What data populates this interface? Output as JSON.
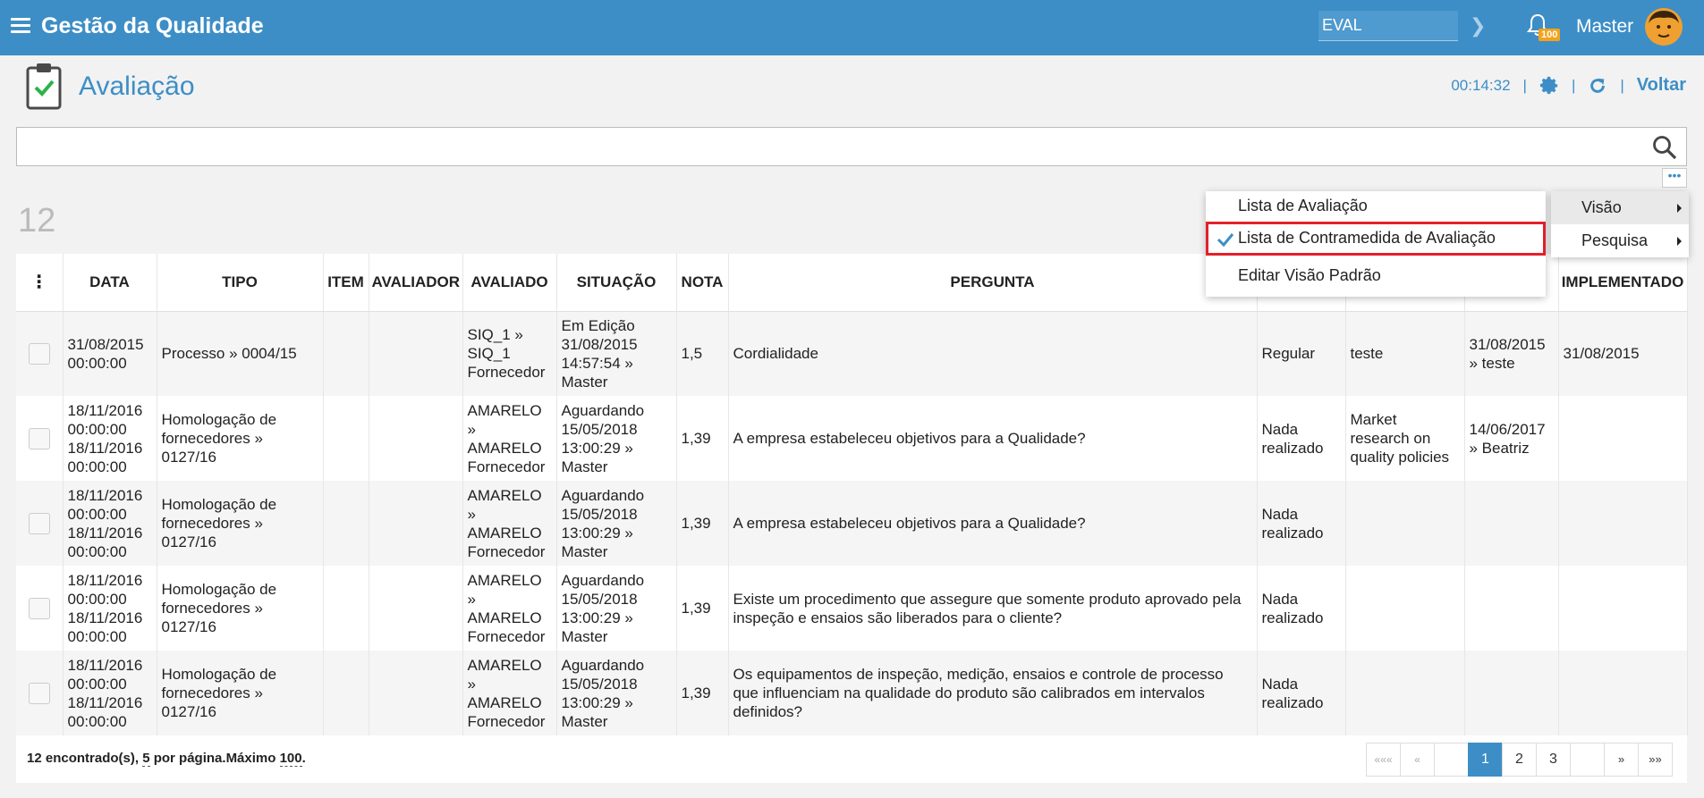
{
  "topbar": {
    "app_title": "Gestão da Qualidade",
    "env_value": "EVAL",
    "notification_count": "100",
    "user_name": "Master"
  },
  "page": {
    "title": "Avaliação",
    "timer": "00:14:32",
    "back_label": "Voltar"
  },
  "search": {
    "value": "",
    "placeholder": ""
  },
  "record_count": "12",
  "table": {
    "headers": [
      "DATA",
      "TIPO",
      "ITEM",
      "AVALIADOR",
      "AVALIADO",
      "SITUAÇÃO",
      "NOTA",
      "PERGUNTA",
      "",
      "",
      "",
      "IMPLEMENTADO"
    ],
    "rows": [
      {
        "data": [
          "31/08/2015",
          "00:00:00"
        ],
        "tipo": "Processo » 0004/15",
        "item": "",
        "avaliador": "",
        "avaliado": [
          "SIQ_1 »",
          "SIQ_1",
          "Fornecedor"
        ],
        "situacao": [
          "Em Edição",
          "31/08/2015",
          "14:57:54 »",
          "Master"
        ],
        "nota": "1,5",
        "pergunta": "Cordialidade",
        "resposta": "Regular",
        "acao": "teste",
        "prazo": "31/08/2015 » teste",
        "implementado": "31/08/2015"
      },
      {
        "data": [
          "18/11/2016",
          "00:00:00",
          "18/11/2016",
          "00:00:00"
        ],
        "tipo": "Homologação de fornecedores » 0127/16",
        "item": "",
        "avaliador": "",
        "avaliado": [
          "AMARELO »",
          "AMARELO",
          "Fornecedor"
        ],
        "situacao": [
          "Aguardando",
          "15/05/2018",
          "13:00:29 »",
          "Master"
        ],
        "nota": "1,39",
        "pergunta": "A empresa estabeleceu objetivos para a Qualidade?",
        "resposta": "Nada realizado",
        "acao": "Market research on quality policies",
        "prazo": "14/06/2017 » Beatriz",
        "implementado": ""
      },
      {
        "data": [
          "18/11/2016",
          "00:00:00",
          "18/11/2016",
          "00:00:00"
        ],
        "tipo": "Homologação de fornecedores » 0127/16",
        "item": "",
        "avaliador": "",
        "avaliado": [
          "AMARELO »",
          "AMARELO",
          "Fornecedor"
        ],
        "situacao": [
          "Aguardando",
          "15/05/2018",
          "13:00:29 »",
          "Master"
        ],
        "nota": "1,39",
        "pergunta": "A empresa estabeleceu objetivos para a Qualidade?",
        "resposta": "Nada realizado",
        "acao": "",
        "prazo": "",
        "implementado": ""
      },
      {
        "data": [
          "18/11/2016",
          "00:00:00",
          "18/11/2016",
          "00:00:00"
        ],
        "tipo": "Homologação de fornecedores » 0127/16",
        "item": "",
        "avaliador": "",
        "avaliado": [
          "AMARELO »",
          "AMARELO",
          "Fornecedor"
        ],
        "situacao": [
          "Aguardando",
          "15/05/2018",
          "13:00:29 »",
          "Master"
        ],
        "nota": "1,39",
        "pergunta": "Existe um procedimento que assegure que somente produto aprovado pela inspeção e ensaios são liberados para o cliente?",
        "resposta": "Nada realizado",
        "acao": "",
        "prazo": "",
        "implementado": ""
      },
      {
        "data": [
          "18/11/2016",
          "00:00:00",
          "18/11/2016",
          "00:00:00"
        ],
        "tipo": "Homologação de fornecedores » 0127/16",
        "item": "",
        "avaliador": "",
        "avaliado": [
          "AMARELO »",
          "AMARELO",
          "Fornecedor"
        ],
        "situacao": [
          "Aguardando",
          "15/05/2018",
          "13:00:29 »",
          "Master"
        ],
        "nota": "1,39",
        "pergunta": "Os equipamentos de inspeção, medição, ensaios e controle de processo que influenciam na qualidade do produto são calibrados em intervalos definidos?",
        "resposta": "Nada realizado",
        "acao": "",
        "prazo": "",
        "implementado": ""
      }
    ]
  },
  "footer": {
    "found_prefix": "12 encontrado(s), ",
    "per_page": "5",
    "per_page_suffix": " por página.",
    "max_label": "Máximo ",
    "max_value": "100",
    "max_suffix": "."
  },
  "pagination": {
    "first": "«««",
    "prev": "«",
    "pages": [
      "1",
      "2",
      "3"
    ],
    "next": "»",
    "last": "»»",
    "current": "1"
  },
  "view_menu": {
    "items": [
      "Lista de Avaliação",
      "Lista de Contramedida de Avaliação",
      "Editar Visão Padrão"
    ],
    "selected_index": 1
  },
  "side_menu": {
    "items": [
      "Visão",
      "Pesquisa"
    ]
  },
  "colors": {
    "brand": "#3d8ec6",
    "badge": "#f4a21b",
    "highlight": "#e3202b"
  }
}
